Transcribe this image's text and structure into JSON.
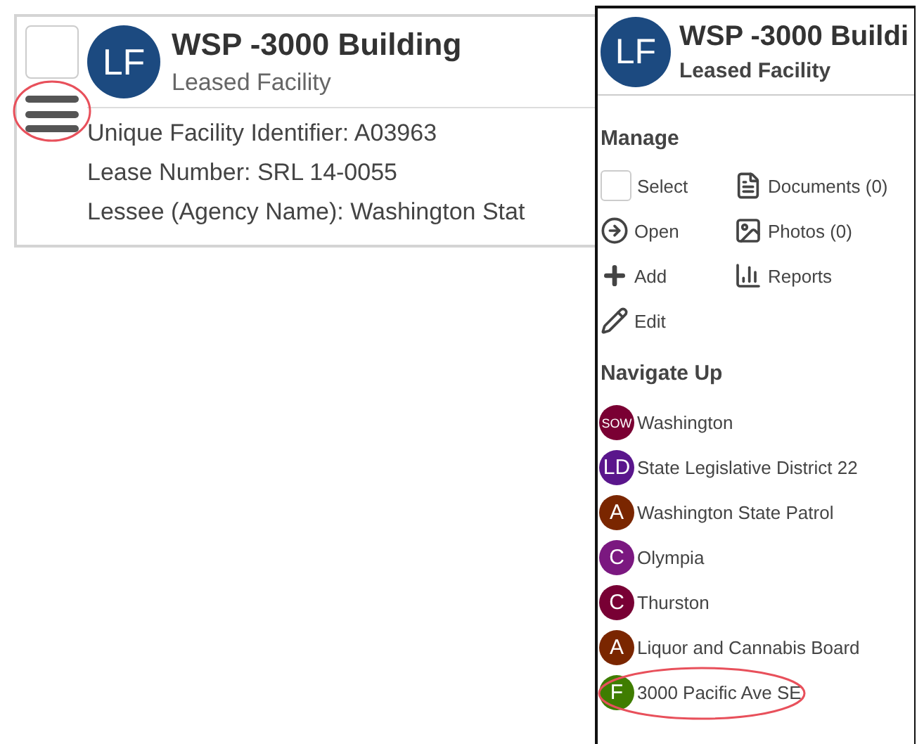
{
  "card": {
    "checked": false,
    "badge": "LF",
    "title": "WSP -3000 Building",
    "subtitle": "Leased Facility",
    "menu_highlighted": true,
    "details": [
      "Unique Facility Identifier: A03963",
      "Lease Number: SRL 14-0055",
      "Lessee (Agency Name): Washington Stat"
    ]
  },
  "panel": {
    "badge": "LF",
    "title": "WSP -3000 Buildi",
    "subtitle": "Leased Facility",
    "manage_heading": "Manage",
    "actions": [
      {
        "kind": "select",
        "label": "Select",
        "checked": false
      },
      {
        "kind": "documents",
        "label": "Documents (0)"
      },
      {
        "kind": "open",
        "label": "Open"
      },
      {
        "kind": "photos",
        "label": "Photos (0)"
      },
      {
        "kind": "add",
        "label": "Add"
      },
      {
        "kind": "reports",
        "label": "Reports"
      },
      {
        "kind": "edit",
        "label": "Edit"
      }
    ],
    "navigate_heading": "Navigate Up",
    "navigate": [
      {
        "badge": "SOW",
        "label": "Washington",
        "color": "#7a0033",
        "highlighted": false
      },
      {
        "badge": "LD",
        "label": "State Legislative District 22",
        "color": "#5a168c",
        "highlighted": false
      },
      {
        "badge": "A",
        "label": "Washington State Patrol",
        "color": "#7a2600",
        "highlighted": false
      },
      {
        "badge": "C",
        "label": "Olympia",
        "color": "#7b1880",
        "highlighted": false
      },
      {
        "badge": "C",
        "label": "Thurston",
        "color": "#780034",
        "highlighted": false
      },
      {
        "badge": "A",
        "label": "Liquor and Cannabis Board",
        "color": "#7a2600",
        "highlighted": false
      },
      {
        "badge": "F",
        "label": "3000 Pacific Ave SE",
        "color": "#3f7d00",
        "highlighted": true
      }
    ]
  }
}
